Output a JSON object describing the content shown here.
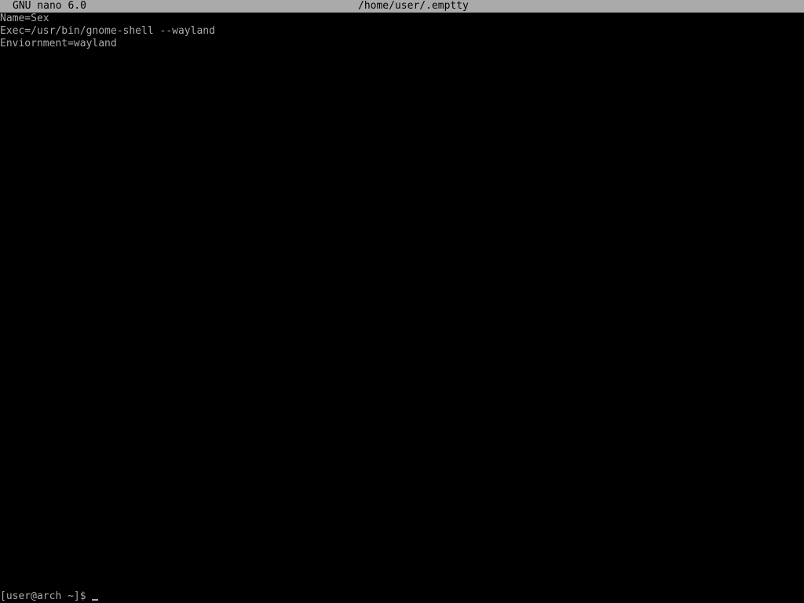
{
  "titlebar": {
    "app_version": "GNU nano 6.0",
    "file_path": "/home/user/.emptty"
  },
  "editor": {
    "lines": [
      "Name=Sex",
      "Exec=/usr/bin/gnome-shell --wayland",
      "Enviornment=wayland"
    ]
  },
  "shell": {
    "prompt": "[user@arch ~]$ "
  },
  "colors": {
    "background": "#000000",
    "foreground": "#aaaaaa",
    "titlebar_background": "#aaaaaa",
    "titlebar_foreground": "#000000"
  }
}
